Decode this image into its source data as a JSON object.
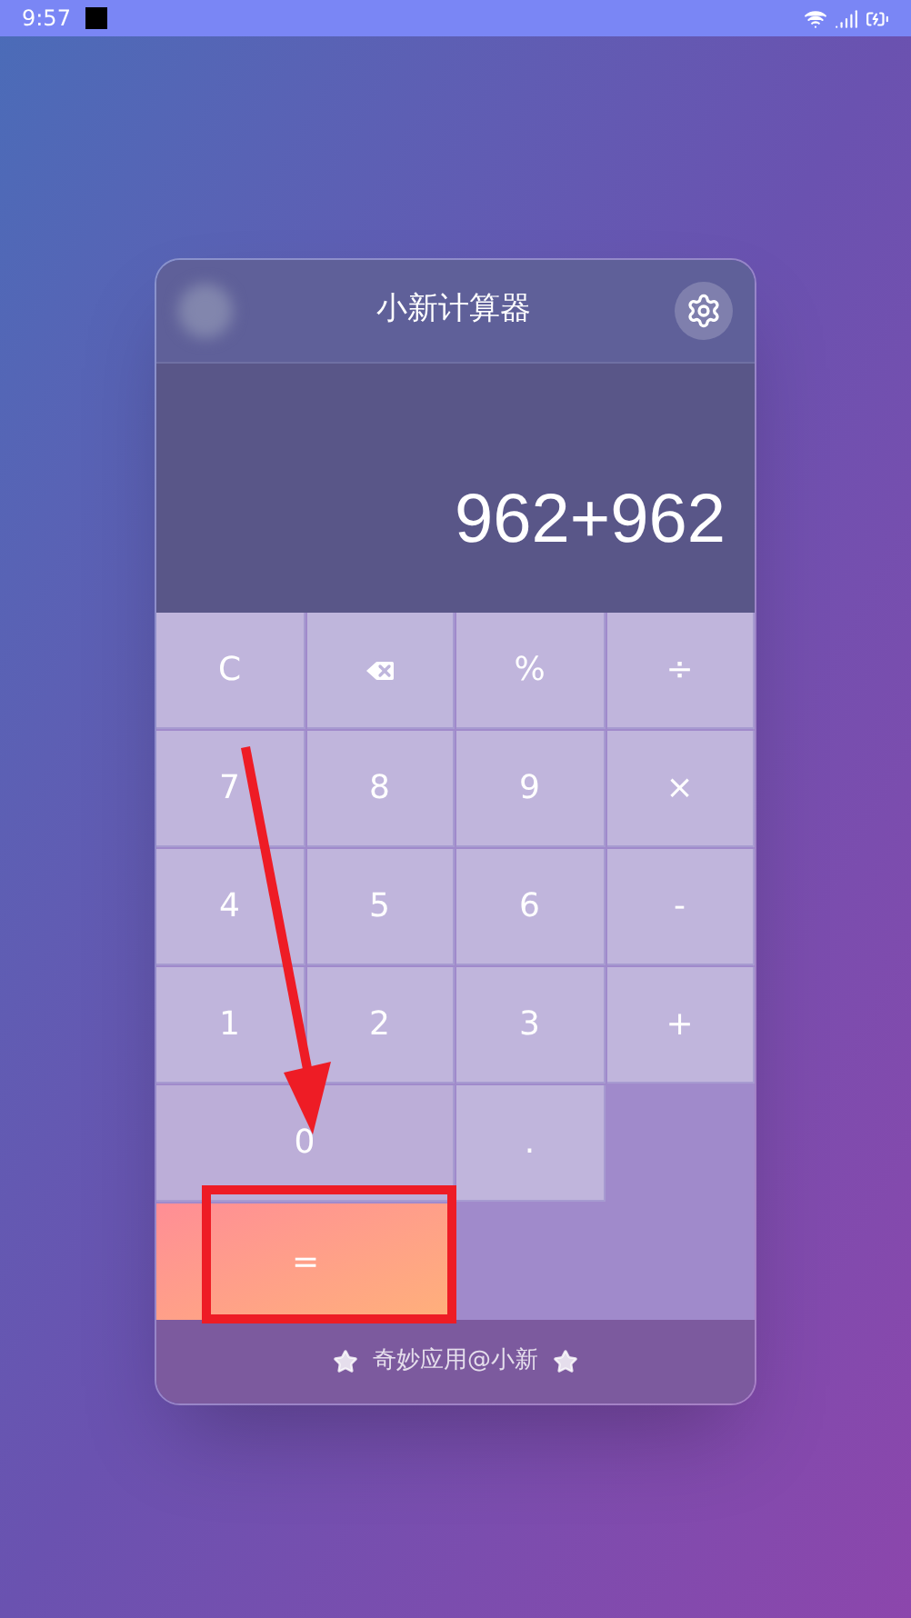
{
  "status_bar": {
    "time": "9:57"
  },
  "header": {
    "title": "小新计算器"
  },
  "display": {
    "expression": "962+962"
  },
  "keys": [
    {
      "kind": "text",
      "label": "C"
    },
    {
      "kind": "backspace"
    },
    {
      "kind": "text",
      "label": "%"
    },
    {
      "kind": "text",
      "label": "÷"
    },
    {
      "kind": "text",
      "label": "7"
    },
    {
      "kind": "text",
      "label": "8"
    },
    {
      "kind": "text",
      "label": "9"
    },
    {
      "kind": "text",
      "label": "×"
    },
    {
      "kind": "text",
      "label": "4"
    },
    {
      "kind": "text",
      "label": "5"
    },
    {
      "kind": "text",
      "label": "6"
    },
    {
      "kind": "text",
      "label": "-"
    },
    {
      "kind": "text",
      "label": "1"
    },
    {
      "kind": "text",
      "label": "2"
    },
    {
      "kind": "text",
      "label": "3"
    },
    {
      "kind": "text",
      "label": "+"
    },
    {
      "kind": "wide",
      "label": "0"
    },
    {
      "kind": "text",
      "label": "."
    },
    {
      "kind": "blank"
    },
    {
      "kind": "equals",
      "label": "="
    }
  ],
  "footer": {
    "text": "奇妙应用@小新"
  }
}
